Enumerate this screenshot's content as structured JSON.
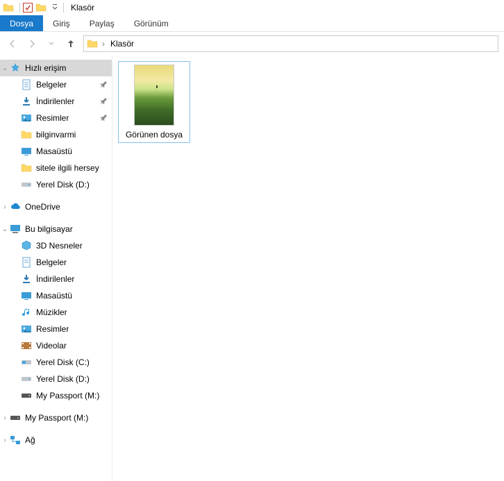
{
  "window": {
    "title": "Klasör"
  },
  "ribbon": {
    "tabs": {
      "file": "Dosya",
      "home": "Giriş",
      "share": "Paylaş",
      "view": "Görünüm"
    }
  },
  "breadcrumb": {
    "segment": "Klasör"
  },
  "sidebar": {
    "quick": "Hızlı erişim",
    "quick_children": {
      "belgeler": "Belgeler",
      "indirilenler": "İndirilenler",
      "resimler": "Resimler",
      "bilginvarmi": "bilginvarmi",
      "masaustu": "Masaüstü",
      "sitele": "sitele ilgili hersey",
      "diskd": "Yerel Disk (D:)"
    },
    "onedrive": "OneDrive",
    "thispc": "Bu bilgisayar",
    "thispc_children": {
      "n3d": "3D Nesneler",
      "belgeler": "Belgeler",
      "indirilenler": "İndirilenler",
      "masaustu": "Masaüstü",
      "muzikler": "Müzikler",
      "resimler": "Resimler",
      "videolar": "Videolar",
      "diskc": "Yerel Disk (C:)",
      "diskd": "Yerel Disk (D:)",
      "passport": "My Passport (M:)"
    },
    "passport_root": "My Passport (M:)",
    "network": "Ağ"
  },
  "files": {
    "item1": "Görünen dosya"
  }
}
